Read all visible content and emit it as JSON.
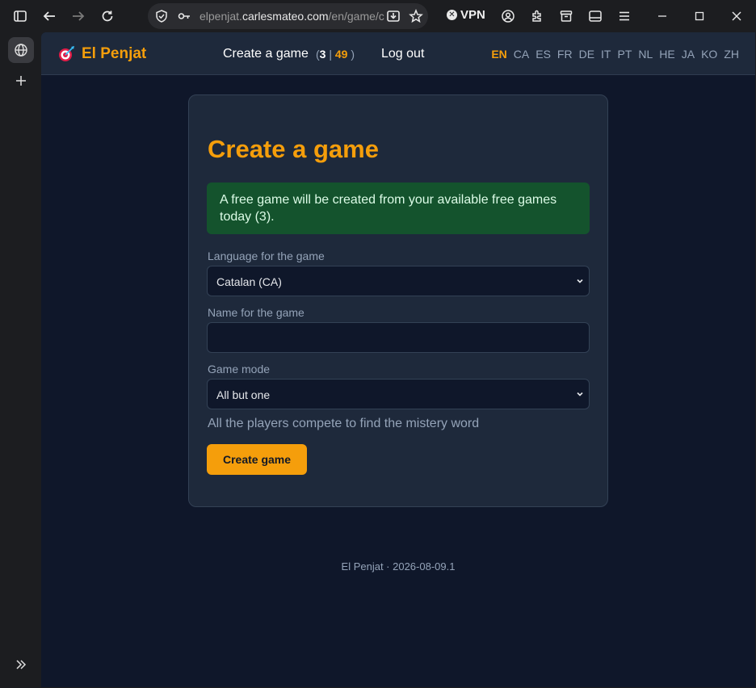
{
  "browser": {
    "url_prefix": "elpenjat.",
    "url_host": "carlesmateo.com",
    "url_path": "/en/game/c",
    "vpn_label": "VPN"
  },
  "header": {
    "logo_text": "El Penjat",
    "nav_create": "Create a game",
    "count_open": "(",
    "count_free": "3",
    "count_sep": "|",
    "count_total": "49",
    "count_close": ")",
    "nav_logout": "Log out",
    "languages": [
      "EN",
      "CA",
      "ES",
      "FR",
      "DE",
      "IT",
      "PT",
      "NL",
      "HE",
      "JA",
      "KO",
      "ZH"
    ],
    "active_language": "EN"
  },
  "form": {
    "title": "Create a game",
    "notice": "A free game will be created from your available free games today (3).",
    "language_label": "Language for the game",
    "language_value": "Catalan (CA)",
    "name_label": "Name for the game",
    "name_value": "",
    "mode_label": "Game mode",
    "mode_value": "All but one",
    "mode_hint": "All the players compete to find the mistery word",
    "submit_label": "Create game"
  },
  "footer": {
    "text": "El Penjat · 2026-08-09.1"
  },
  "colors": {
    "accent": "#f59e0b",
    "background": "#0f172a",
    "card": "#1e293b",
    "notice": "#14532d"
  }
}
